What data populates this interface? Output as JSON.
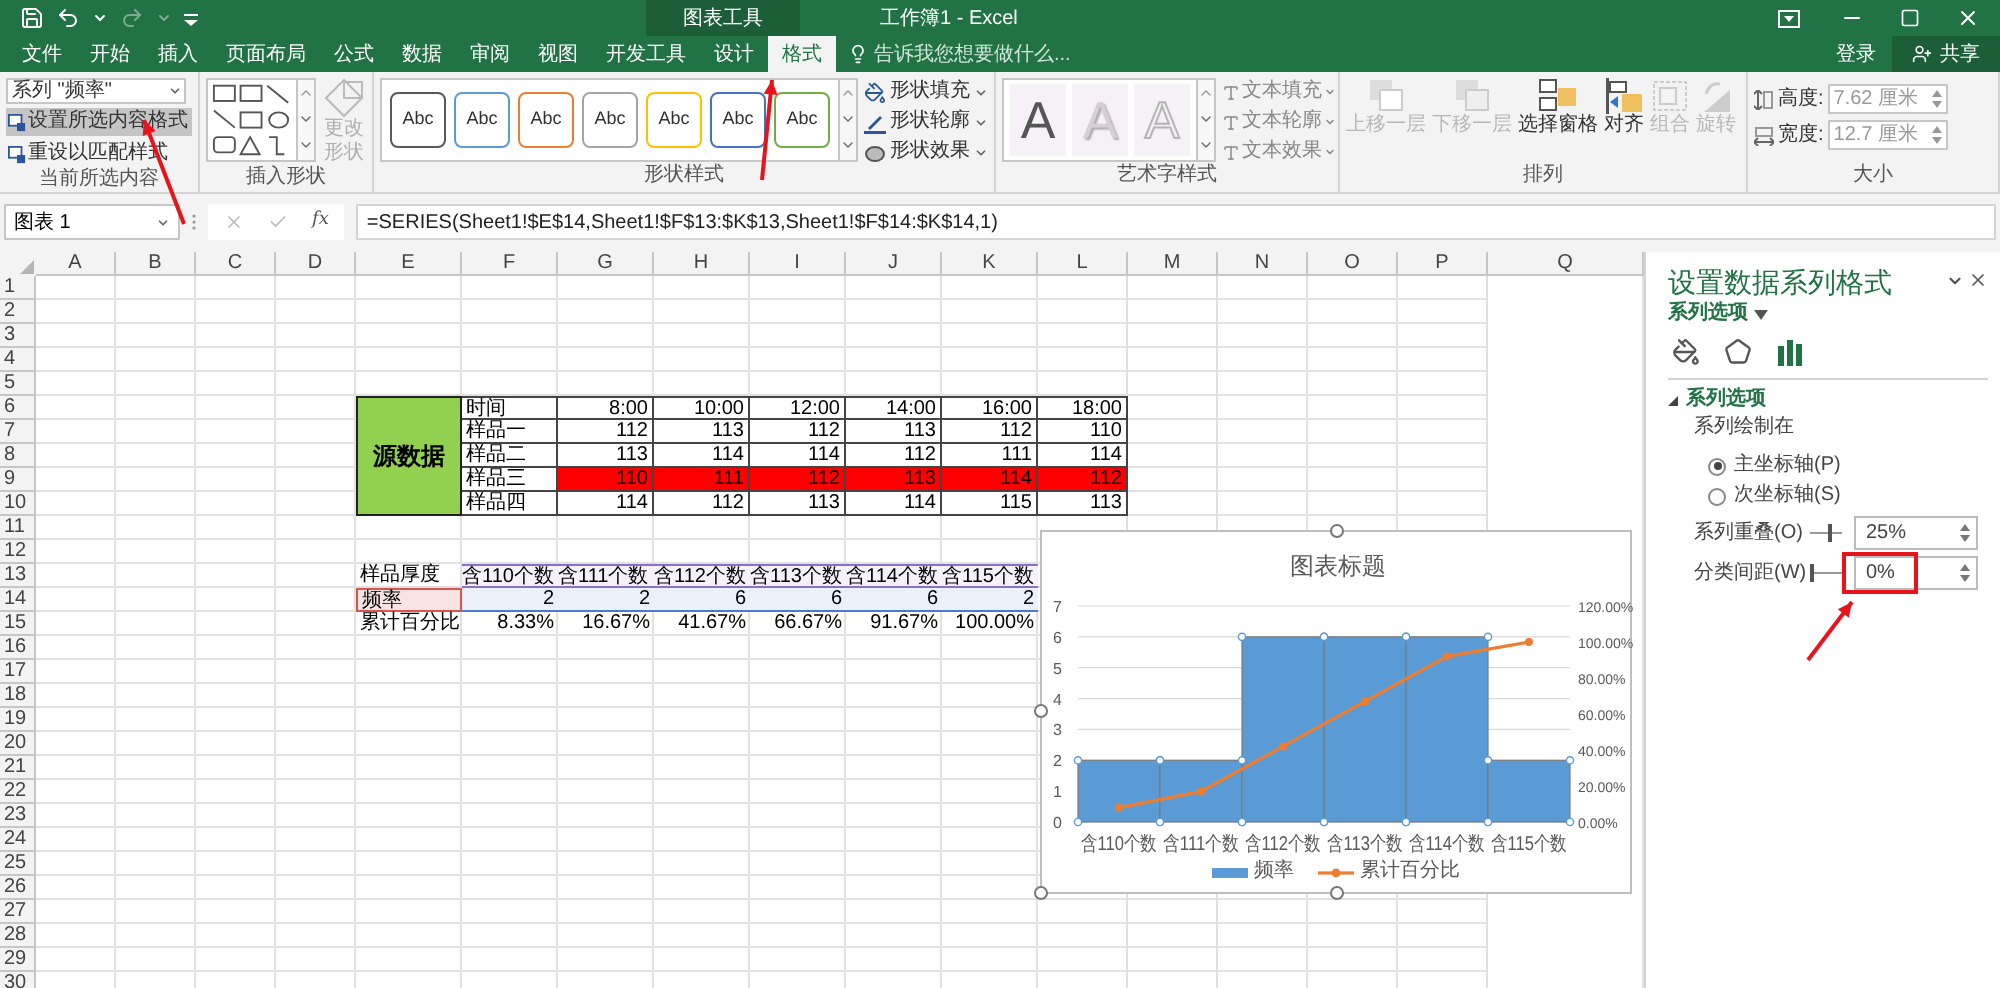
{
  "title_bar": {
    "contextual_group": "图表工具",
    "title": "工作簿1 - Excel"
  },
  "tabs": [
    {
      "label": "文件",
      "selected": false
    },
    {
      "label": "开始",
      "selected": false
    },
    {
      "label": "插入",
      "selected": false
    },
    {
      "label": "页面布局",
      "selected": false
    },
    {
      "label": "公式",
      "selected": false
    },
    {
      "label": "数据",
      "selected": false
    },
    {
      "label": "审阅",
      "selected": false
    },
    {
      "label": "视图",
      "selected": false
    },
    {
      "label": "开发工具",
      "selected": false
    },
    {
      "label": "设计",
      "selected": false
    },
    {
      "label": "格式",
      "selected": true
    }
  ],
  "tell_me": {
    "placeholder": "告诉我您想要做什么..."
  },
  "account": {
    "sign_in": "登录",
    "share": "共享"
  },
  "ribbon": {
    "selection": {
      "label": "当前所选内容",
      "dropdown": "系列 \"频率\"",
      "buttons": [
        {
          "label": "设置所选内容格式",
          "selected": true
        },
        {
          "label": "重设以匹配样式",
          "selected": false
        }
      ]
    },
    "insert_shapes": {
      "label": "插入形状",
      "change_shape": {
        "label": "更改形状",
        "disabled": true
      }
    },
    "shape_styles": {
      "label": "形状样式",
      "swatches": [
        {
          "label": "Abc",
          "color": "#595959"
        },
        {
          "label": "Abc",
          "color": "#5b9bd5"
        },
        {
          "label": "Abc",
          "color": "#ed7d31"
        },
        {
          "label": "Abc",
          "color": "#a5a5a5"
        },
        {
          "label": "Abc",
          "color": "#ffc000"
        },
        {
          "label": "Abc",
          "color": "#4472c4"
        },
        {
          "label": "Abc",
          "color": "#70ad47"
        }
      ],
      "commands": [
        {
          "label": "形状填充",
          "kind": "fill"
        },
        {
          "label": "形状轮廓",
          "kind": "outline"
        },
        {
          "label": "形状效果",
          "kind": "effect"
        }
      ]
    },
    "wordart_styles": {
      "label": "艺术字样式",
      "styles": [
        {
          "label": "A",
          "kind": "solid"
        },
        {
          "label": "A",
          "kind": "shadow"
        },
        {
          "label": "A",
          "kind": "outline"
        }
      ],
      "commands": [
        "文本填充",
        "文本轮廓",
        "文本效果"
      ]
    },
    "arrange": {
      "label": "排列",
      "commands": [
        {
          "label": "上移一层",
          "kind": "forward",
          "disabled": true
        },
        {
          "label": "下移一层",
          "kind": "backward",
          "disabled": true
        },
        {
          "label": "选择窗格",
          "kind": "pane",
          "disabled": false
        },
        {
          "label": "对齐",
          "kind": "align",
          "disabled": false
        },
        {
          "label": "组合",
          "kind": "group",
          "disabled": true
        },
        {
          "label": "旋转",
          "kind": "rotate",
          "disabled": true
        }
      ]
    },
    "size": {
      "label": "大小",
      "fields": [
        {
          "label": "高度:",
          "value": "7.62 厘米",
          "kind": "height"
        },
        {
          "label": "宽度:",
          "value": "12.7 厘米",
          "kind": "width"
        }
      ]
    }
  },
  "formula_bar": {
    "name_box": "图表 1",
    "function_label": "fx",
    "formula": "=SERIES(Sheet1!$E$14,Sheet1!$F$13:$K$13,Sheet1!$F$14:$K$14,1)"
  },
  "sheet": {
    "columns": [
      "A",
      "B",
      "C",
      "D",
      "E",
      "F",
      "G",
      "H",
      "I",
      "J",
      "K",
      "L",
      "M",
      "N",
      "O",
      "P",
      "Q"
    ],
    "row_numbers": [
      "1",
      "2",
      "3",
      "4",
      "5",
      "6",
      "7",
      "8",
      "9",
      "10",
      "11",
      "12",
      "13",
      "14",
      "15",
      "16",
      "17",
      "18",
      "19",
      "20",
      "21",
      "22",
      "23",
      "24",
      "25",
      "26",
      "27",
      "28",
      "29",
      "30"
    ],
    "source_table": {
      "title": "源数据",
      "rows": [
        {
          "label": "时间",
          "values": [
            "8:00",
            "10:00",
            "12:00",
            "14:00",
            "16:00",
            "18:00"
          ],
          "highlight": false
        },
        {
          "label": "样品一",
          "values": [
            "112",
            "113",
            "112",
            "113",
            "112",
            "110"
          ],
          "highlight": false
        },
        {
          "label": "样品二",
          "values": [
            "113",
            "114",
            "114",
            "112",
            "111",
            "114"
          ],
          "highlight": false
        },
        {
          "label": "样品三",
          "values": [
            "110",
            "111",
            "112",
            "113",
            "114",
            "112"
          ],
          "highlight": true
        },
        {
          "label": "样品四",
          "values": [
            "114",
            "112",
            "113",
            "114",
            "115",
            "113"
          ],
          "highlight": false
        }
      ]
    },
    "summary_table": {
      "rows": [
        {
          "label": "样品厚度",
          "values": [
            "含110个数",
            "含111个数",
            "含112个数",
            "含113个数",
            "含114个数",
            "含115个数"
          ],
          "kind": "categories"
        },
        {
          "label": "频率",
          "values": [
            "2",
            "2",
            "6",
            "6",
            "6",
            "2"
          ],
          "kind": "series"
        },
        {
          "label": "累计百分比",
          "values": [
            "8.33%",
            "16.67%",
            "41.67%",
            "66.67%",
            "91.67%",
            "100.00%"
          ],
          "kind": "plain"
        }
      ]
    }
  },
  "chart": {
    "bars": {
      "chart_data": {
        "type": "bar",
        "title": "图表标题",
        "categories": [
          "含110个数",
          "含111个数",
          "含112个数",
          "含113个数",
          "含114个数",
          "含115个数"
        ],
        "series": [
          {
            "name": "频率",
            "color": "#5b9bd5",
            "values": [
              2,
              2,
              6,
              6,
              6,
              2
            ]
          }
        ],
        "ylim": [
          0,
          7
        ],
        "yticks": [
          0,
          1,
          2,
          3,
          4,
          5,
          6,
          7
        ],
        "grid": true
      }
    },
    "line": {
      "chart_data": {
        "type": "line",
        "series": [
          {
            "name": "累计百分比",
            "color": "#ed7d31",
            "marker": true,
            "values": [
              8,
              17,
              42,
              67,
              92,
              100
            ]
          }
        ],
        "ylim": [
          0,
          120
        ],
        "yticks": [
          {
            "value": 0,
            "label": "0.00%"
          },
          {
            "value": 20,
            "label": "20.00%"
          },
          {
            "value": 40,
            "label": "40.00%"
          },
          {
            "value": 60,
            "label": "60.00%"
          },
          {
            "value": 80,
            "label": "80.00%"
          },
          {
            "value": 100,
            "label": "100.00%"
          },
          {
            "value": 120,
            "label": "120.00%"
          }
        ]
      }
    }
  },
  "format_pane": {
    "title": "设置数据系列格式",
    "options_menu": "系列选项",
    "icons": [
      {
        "kind": "fill",
        "selected": false
      },
      {
        "kind": "shape",
        "selected": false
      },
      {
        "kind": "series",
        "selected": true
      }
    ],
    "section": {
      "title": "系列选项",
      "expanded": true,
      "plot_on_label": "系列绘制在",
      "axes": [
        {
          "label": "主坐标轴(P)",
          "selected": true
        },
        {
          "label": "次坐标轴(S)",
          "selected": false
        }
      ],
      "settings": [
        {
          "label": "系列重叠(O)",
          "level": 0.625,
          "value": "25%"
        },
        {
          "label": "分类间距(W)",
          "level": 0,
          "value": "0%"
        }
      ]
    }
  }
}
